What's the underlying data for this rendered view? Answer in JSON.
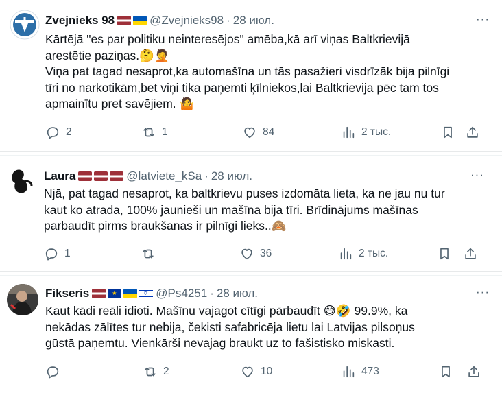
{
  "tweets": [
    {
      "name": "Zvejnieks 98",
      "flags": [
        "lv",
        "ua"
      ],
      "handle": "@Zvejnieks98",
      "dot": "·",
      "date": "28 июл.",
      "lines": [
        "Kārtējā \"es par politiku neinteresējos\" amēba,kā arī viņas Baltkrievijā",
        "arestētie paziņas.🤔🤦",
        "Viņa pat tagad nesaprot,ka automašīna un tās pasažieri visdrīzāk bija pilnīgi",
        "tīri no narkotikām,bet viņi tika paņemti ķīlniekos,lai Baltkrievija pēc tam tos",
        "apmainītu pret savējiem. 🤷"
      ],
      "replies": "2",
      "reposts": "1",
      "likes": "84",
      "views": "2 тыс."
    },
    {
      "name": "Laura",
      "flags": [
        "lv",
        "lv",
        "lv"
      ],
      "handle": "@latviete_kSa",
      "dot": "·",
      "date": "28 июл.",
      "lines": [
        "Njā, pat tagad nesaprot, ka baltkrievu puses izdomāta lieta, ka ne jau nu tur",
        "kaut ko atrada, 100% jaunieši un mašīna bija tīri. Brīdinājums mašīnas",
        "parbaudīt pirms braukšanas ir pilnīgi lieks..🙈"
      ],
      "replies": "1",
      "reposts": "",
      "likes": "36",
      "views": "2 тыс."
    },
    {
      "name": "Fikseris",
      "flags": [
        "lv",
        "eu",
        "ua",
        "il"
      ],
      "handle": "@Ps4251",
      "dot": "·",
      "date": "28 июл.",
      "lines": [
        "Kaut kādi reāli idioti. Mašīnu vajagot cītīgi pārbaudīt 😅🤣 99.9%, ka",
        "nekādas zālītes tur nebija, čekisti safabricēja lietu lai Latvijas pilsoņus",
        "gūstā paņemtu. Vienkārši nevajag braukt uz to fašistisko miskasti."
      ],
      "replies": "",
      "reposts": "2",
      "likes": "10",
      "views": "473"
    }
  ],
  "more_label": "···",
  "icons": {
    "reply": "reply-icon",
    "repost": "repost-icon",
    "like": "heart-icon",
    "views": "views-icon",
    "bookmark": "bookmark-icon",
    "share": "share-icon"
  },
  "colors": {
    "text": "#0f1419",
    "secondary": "#536471",
    "divider": "#e7e9ea"
  }
}
